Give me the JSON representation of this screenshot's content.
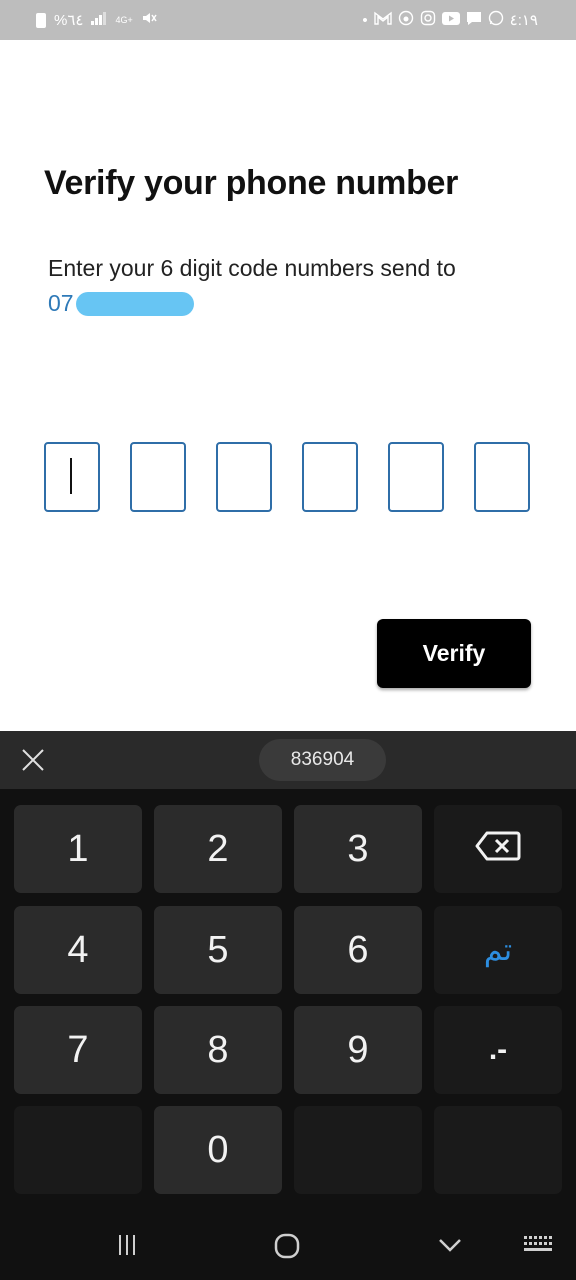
{
  "status_bar": {
    "battery_pct": "%٦٤",
    "network": "4G+",
    "time": "٤:١٩"
  },
  "screen": {
    "title": "Verify your phone number",
    "subtitle": "Enter your 6 digit code numbers send to",
    "phone_visible": "07"
  },
  "otp": {
    "digits": [
      "",
      "",
      "",
      "",
      "",
      ""
    ],
    "active_index": 0
  },
  "verify_button": {
    "label": "Verify"
  },
  "keyboard": {
    "suggestion": "836904",
    "keys": {
      "k1": "1",
      "k2": "2",
      "k3": "3",
      "k4": "4",
      "k5": "5",
      "k6": "6",
      "k7": "7",
      "k8": "8",
      "k9": "9",
      "k0": "0",
      "done": "تم",
      "dot_dash": ".-"
    },
    "icons": [
      "close-icon",
      "backspace-icon"
    ]
  },
  "nav_bar": {
    "icons": [
      "recents-icon",
      "home-icon",
      "back-icon",
      "keyboard-switch-icon"
    ]
  },
  "colors": {
    "accent": "#2f6ea8",
    "link": "#2f7ab8",
    "done_key": "#2d8ee0",
    "redaction": "#67c5f3"
  }
}
